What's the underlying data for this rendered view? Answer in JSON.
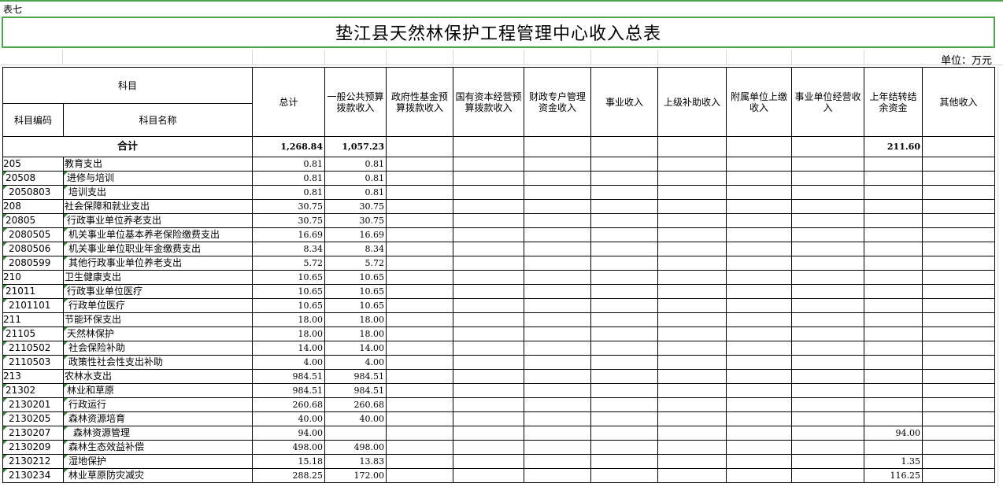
{
  "sheet_tag": "表七",
  "title": "垫江县天然林保护工程管理中心收入总表",
  "unit": "单位：万元",
  "header": {
    "subject": "科目",
    "code": "科目编码",
    "name": "科目名称",
    "columns": [
      "总计",
      "一般公共预算拨款收入",
      "政府性基金预算拨款收入",
      "国有资本经营预算拨款收入",
      "财政专户管理资金收入",
      "事业收入",
      "上级补助收入",
      "附属单位上缴收入",
      "事业单位经营收入",
      "上年结转结余资金",
      "其他收入"
    ]
  },
  "total": {
    "label": "合计",
    "values": [
      "1,268.84",
      "1,057.23",
      "",
      "",
      "",
      "",
      "",
      "",
      "",
      "211.60",
      ""
    ]
  },
  "rows": [
    {
      "code": "205",
      "name": "教育支出",
      "total": "0.81",
      "general": "0.81",
      "carry": ""
    },
    {
      "code": "20508",
      "name": "进修与培训",
      "total": "0.81",
      "general": "0.81",
      "carry": ""
    },
    {
      "code": "2050803",
      "name": "培训支出",
      "total": "0.81",
      "general": "0.81",
      "carry": ""
    },
    {
      "code": "208",
      "name": "社会保障和就业支出",
      "total": "30.75",
      "general": "30.75",
      "carry": ""
    },
    {
      "code": "20805",
      "name": "行政事业单位养老支出",
      "total": "30.75",
      "general": "30.75",
      "carry": ""
    },
    {
      "code": "2080505",
      "name": "机关事业单位基本养老保险缴费支出",
      "total": "16.69",
      "general": "16.69",
      "carry": ""
    },
    {
      "code": "2080506",
      "name": "机关事业单位职业年金缴费支出",
      "total": "8.34",
      "general": "8.34",
      "carry": ""
    },
    {
      "code": "2080599",
      "name": "其他行政事业单位养老支出",
      "total": "5.72",
      "general": "5.72",
      "carry": ""
    },
    {
      "code": "210",
      "name": "卫生健康支出",
      "total": "10.65",
      "general": "10.65",
      "carry": ""
    },
    {
      "code": "21011",
      "name": "行政事业单位医疗",
      "total": "10.65",
      "general": "10.65",
      "carry": ""
    },
    {
      "code": "2101101",
      "name": "行政单位医疗",
      "total": "10.65",
      "general": "10.65",
      "carry": ""
    },
    {
      "code": "211",
      "name": "节能环保支出",
      "total": "18.00",
      "general": "18.00",
      "carry": ""
    },
    {
      "code": "21105",
      "name": "天然林保护",
      "total": "18.00",
      "general": "18.00",
      "carry": ""
    },
    {
      "code": "2110502",
      "name": "社会保险补助",
      "total": "14.00",
      "general": "14.00",
      "carry": ""
    },
    {
      "code": "2110503",
      "name": "政策性社会性支出补助",
      "total": "4.00",
      "general": "4.00",
      "carry": ""
    },
    {
      "code": "213",
      "name": "农林水支出",
      "total": "984.51",
      "general": "984.51",
      "carry": ""
    },
    {
      "code": "21302",
      "name": "林业和草原",
      "total": "984.51",
      "general": "984.51",
      "carry": ""
    },
    {
      "code": "2130201",
      "name": "行政运行",
      "total": "260.68",
      "general": "260.68",
      "carry": ""
    },
    {
      "code": "2130205",
      "name": "森林资源培育",
      "total": "40.00",
      "general": "40.00",
      "carry": ""
    },
    {
      "code": "2130207",
      "name": "森林资源管理",
      "total": "94.00",
      "general": "",
      "carry": "94.00"
    },
    {
      "code": "2130209",
      "name": "森林生态效益补偿",
      "total": "498.00",
      "general": "498.00",
      "carry": ""
    },
    {
      "code": "2130212",
      "name": "湿地保护",
      "total": "15.18",
      "general": "13.83",
      "carry": "1.35"
    },
    {
      "code": "2130234",
      "name": "林业草原防灾减灾",
      "total": "288.25",
      "general": "172.00",
      "carry": "116.25"
    }
  ]
}
